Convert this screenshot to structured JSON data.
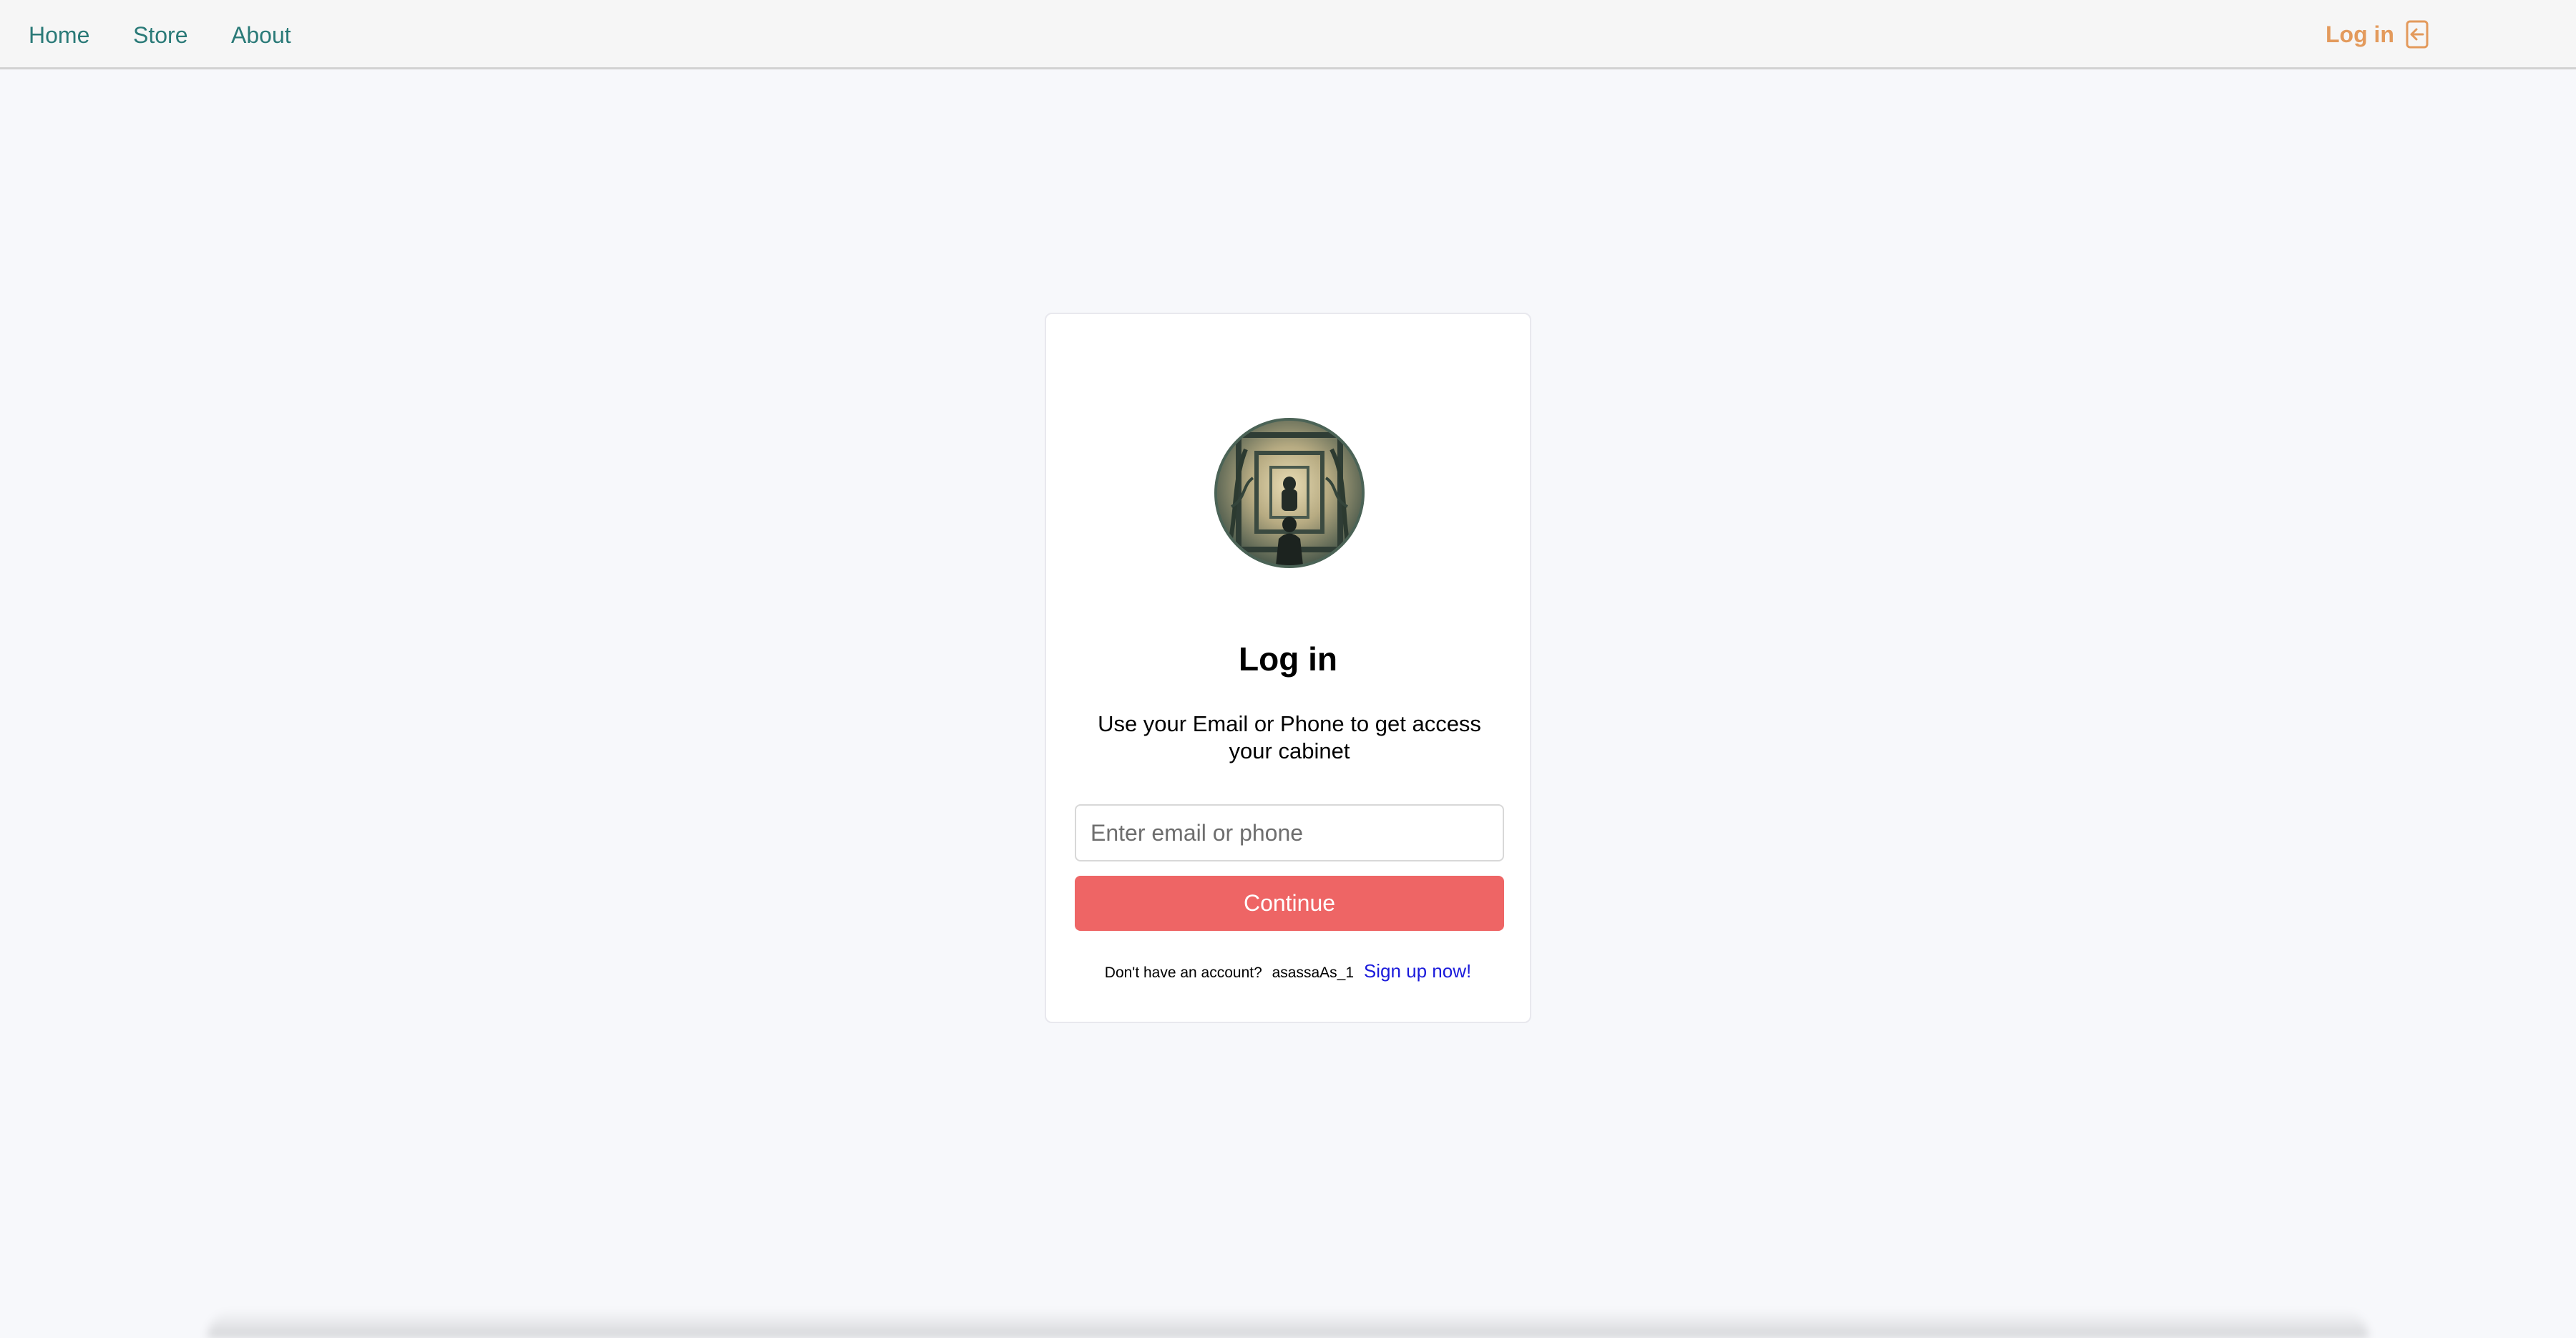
{
  "nav": {
    "links": [
      {
        "label": "Home"
      },
      {
        "label": "Store"
      },
      {
        "label": "About"
      }
    ],
    "login_label": "Log in",
    "login_icon": "login-arrow-icon",
    "link_color": "#2a7a78",
    "login_color": "#e39a5c"
  },
  "card": {
    "title": "Log in",
    "subtitle": "Use your Email or Phone to get access your cabinet",
    "input_placeholder": "Enter email or phone",
    "input_value": "",
    "continue_label": "Continue",
    "continue_color": "#ee6565",
    "no_account_text": "Don't have an account?",
    "username_text": "asassaAs_1",
    "signup_label": "Sign up now!"
  }
}
